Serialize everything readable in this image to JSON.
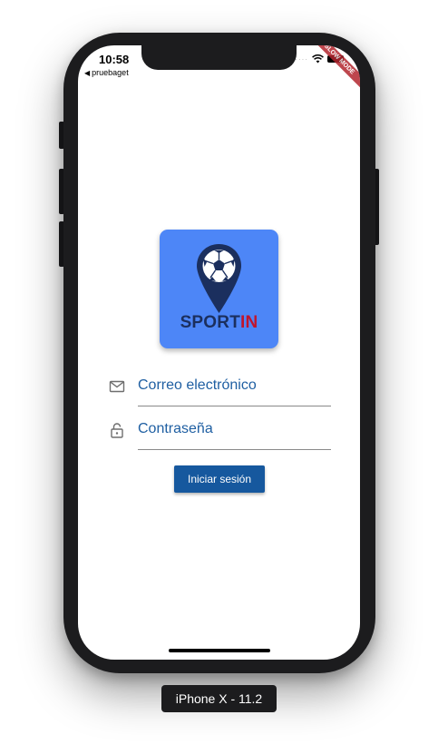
{
  "device": {
    "label": "iPhone X - 11.2"
  },
  "status_bar": {
    "time": "10:58",
    "back_app": "pruebaget",
    "debug_banner": "SLOW MODE"
  },
  "logo": {
    "word_part1": "SPORT",
    "word_part2": "IN",
    "icon": "soccer-ball-pin-icon",
    "colors": {
      "tile": "#4d86f7",
      "dark": "#1b2f5e",
      "accent": "#c0152d"
    }
  },
  "form": {
    "email": {
      "icon": "mail-icon",
      "placeholder": "Correo electrónico"
    },
    "password": {
      "icon": "lock-icon",
      "placeholder": "Contraseña"
    },
    "submit_label": "Iniciar sesión"
  },
  "colors": {
    "primary": "#16589e",
    "field_text": "#1f5fa2"
  }
}
